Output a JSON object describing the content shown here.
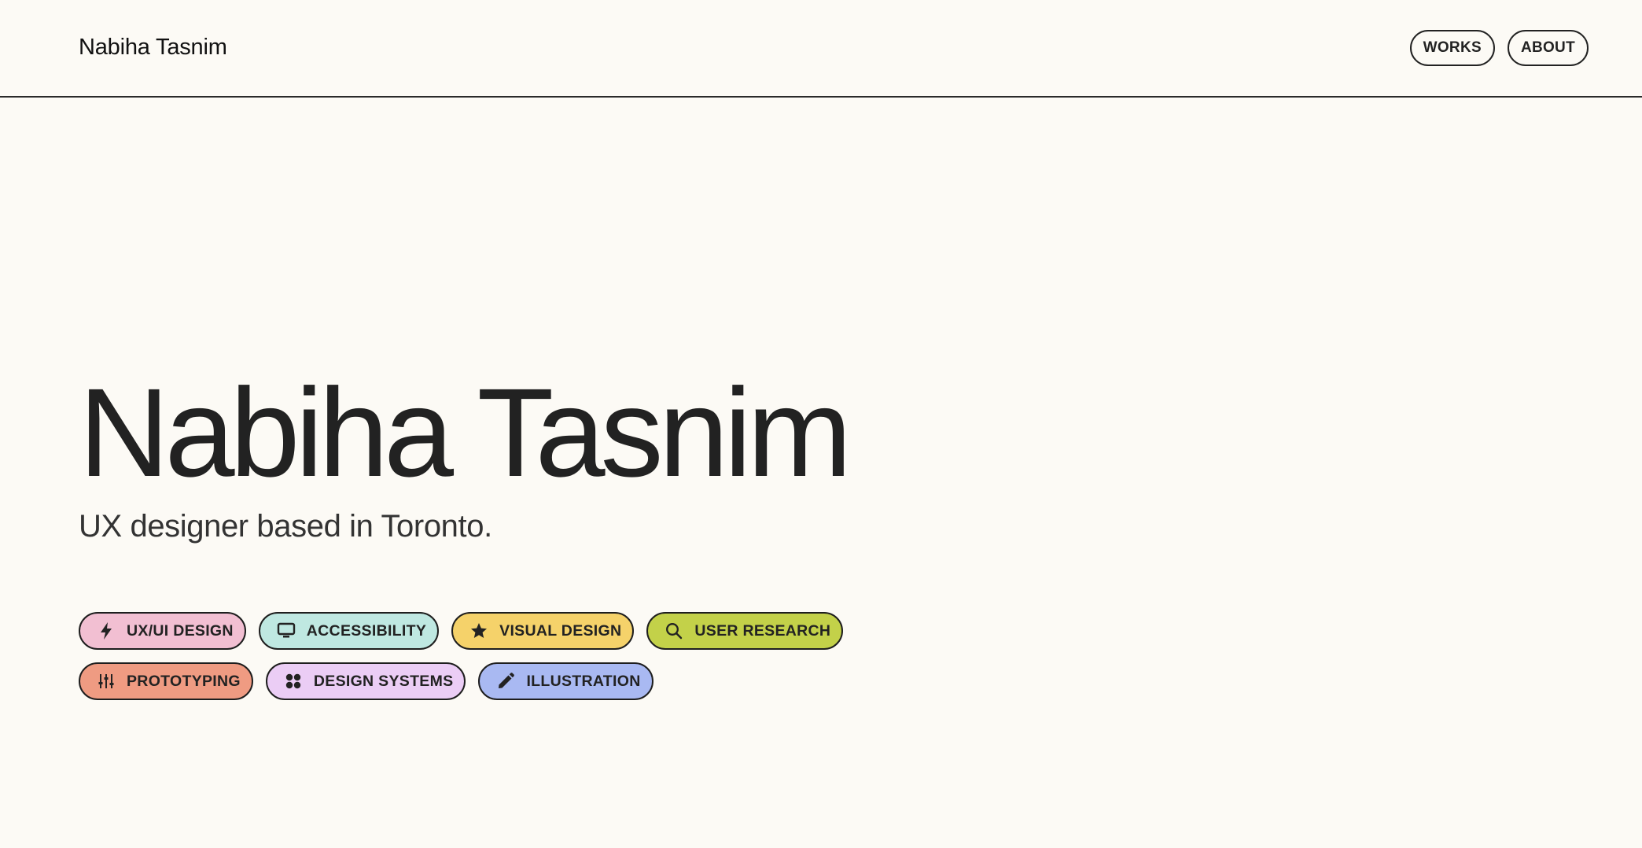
{
  "header": {
    "brand": "Nabiha Tasnim",
    "nav": [
      {
        "label": "WORKS"
      },
      {
        "label": "ABOUT"
      }
    ]
  },
  "hero": {
    "title": "Nabiha Tasnim",
    "subtitle": "UX designer based in Toronto."
  },
  "tags": [
    {
      "label": "UX/UI DESIGN",
      "icon": "lightning-bolt-icon",
      "color": "#f2bfd2"
    },
    {
      "label": "ACCESSIBILITY",
      "icon": "monitor-icon",
      "color": "#bfe8e1"
    },
    {
      "label": "VISUAL DESIGN",
      "icon": "star-icon",
      "color": "#f5d26a"
    },
    {
      "label": "USER RESEARCH",
      "icon": "search-icon",
      "color": "#c3d149"
    },
    {
      "label": "PROTOTYPING",
      "icon": "sliders-icon",
      "color": "#ef9b82"
    },
    {
      "label": "DESIGN SYSTEMS",
      "icon": "grid-icon",
      "color": "#ebcdf5"
    },
    {
      "label": "ILLUSTRATION",
      "icon": "pencil-icon",
      "color": "#a9b9f2"
    }
  ]
}
